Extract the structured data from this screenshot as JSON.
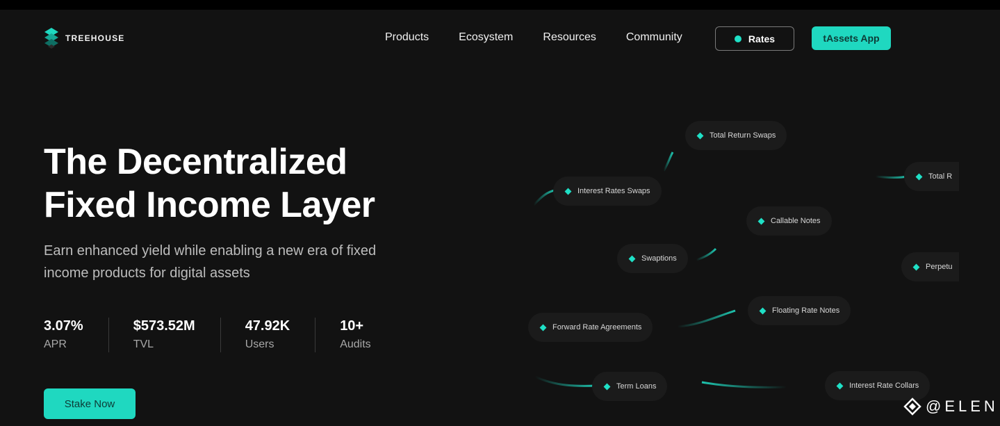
{
  "brand": {
    "name": "TREEHOUSE",
    "accent": "#1fd8c0"
  },
  "nav": {
    "items": [
      "Products",
      "Ecosystem",
      "Resources",
      "Community"
    ]
  },
  "header": {
    "rates_label": "Rates",
    "app_label": "tAssets App"
  },
  "hero": {
    "title_line1": "The Decentralized",
    "title_line2": "Fixed Income Layer",
    "subtitle_line1": "Earn enhanced yield while enabling a new era of fixed",
    "subtitle_line2": "income products for digital assets"
  },
  "stats": [
    {
      "value": "3.07%",
      "label": "APR"
    },
    {
      "value": "$573.52M",
      "label": "TVL"
    },
    {
      "value": "47.92K",
      "label": "Users"
    },
    {
      "value": "10+",
      "label": "Audits"
    }
  ],
  "cta": {
    "stake_label": "Stake Now"
  },
  "products": {
    "total_return_swaps": "Total Return Swaps",
    "total_r": "Total R",
    "interest_rates_swaps": "Interest Rates Swaps",
    "callable_notes": "Callable Notes",
    "swaptions": "Swaptions",
    "perpetu": "Perpetu",
    "floating_rate_notes": "Floating Rate Notes",
    "forward_rate_agreements": "Forward Rate Agreements",
    "term_loans": "Term Loans",
    "interest_rate_collars": "Interest Rate Collars"
  },
  "watermark": {
    "text": "@ELEN",
    "icon": "diamond-logo-icon"
  }
}
